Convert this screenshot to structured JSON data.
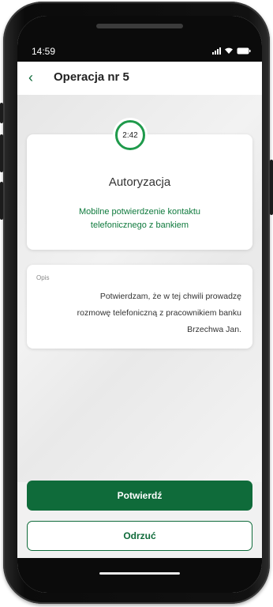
{
  "status_bar": {
    "time": "14:59",
    "icons": [
      "signal-icon",
      "wifi-icon",
      "battery-icon"
    ]
  },
  "header": {
    "back_icon": "‹",
    "title": "Operacja nr 5"
  },
  "auth_card": {
    "timer": "2:42",
    "title": "Autoryzacja",
    "description_line1": "Mobilne potwierdzenie kontaktu",
    "description_line2": "telefonicznego z bankiem"
  },
  "opis_card": {
    "label": "Opis",
    "line1": "Potwierdzam, że w tej chwili prowadzę",
    "line2": "rozmowę telefoniczną z pracownikiem banku",
    "line3": "Brzechwa Jan."
  },
  "actions": {
    "confirm_label": "Potwierdź",
    "reject_label": "Odrzuć"
  },
  "colors": {
    "brand_green": "#0f6b3a",
    "accent_green": "#1f9a4b"
  }
}
